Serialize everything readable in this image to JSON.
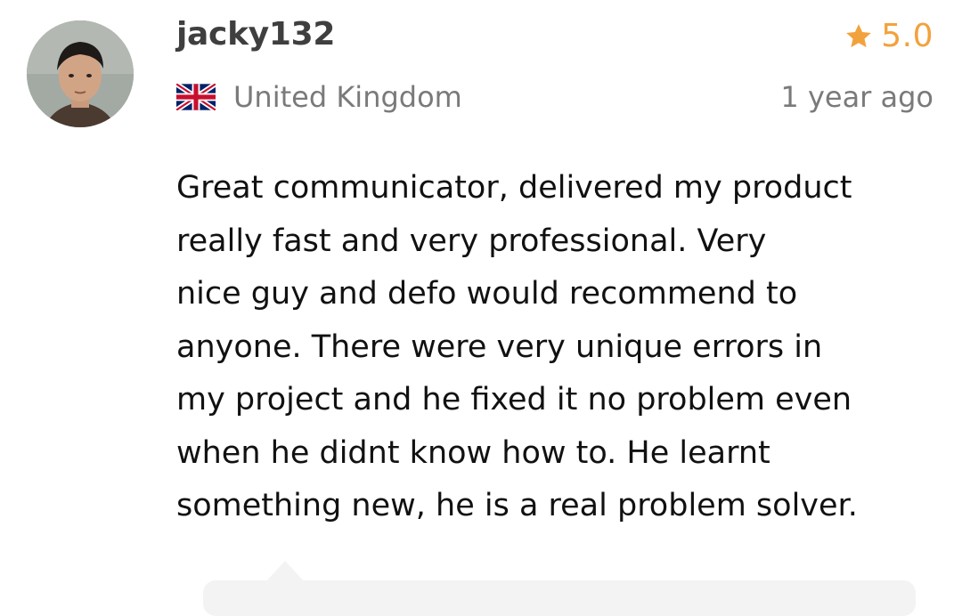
{
  "review": {
    "username": "jacky132",
    "rating": "5.0",
    "country": "United Kingdom",
    "timestamp": "1 year ago",
    "text": "Great communicator, delivered my product\nreally fast and very professional. Very\nnice guy and defo would recommend to\nanyone. There were very unique errors in\nmy project and he fixed it no problem even\nwhen he didnt know how to. He learnt\nsomething new, he is a real problem solver."
  },
  "icons": {
    "rating": "star-icon",
    "country": "uk-flag-icon"
  },
  "colors": {
    "star": "#f2a23c",
    "username": "#3f3f3f",
    "muted": "#7a7a7a",
    "text": "#111111"
  }
}
